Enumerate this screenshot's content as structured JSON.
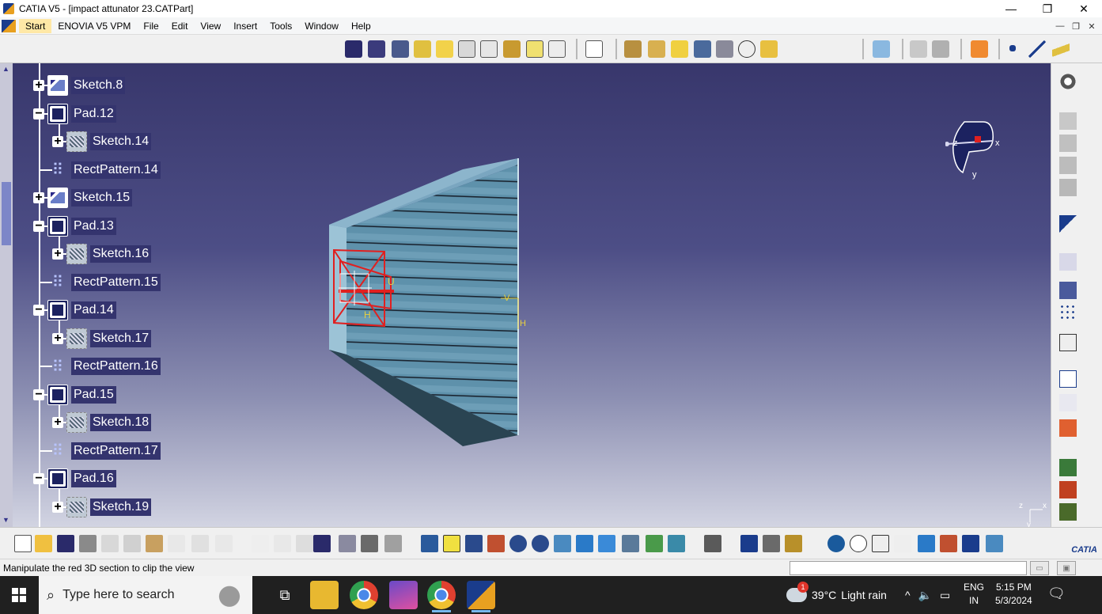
{
  "window": {
    "title": "CATIA V5 - [impact attunator 23.CATPart]",
    "minimize": "—",
    "restore": "❐",
    "close": "✕"
  },
  "menu": {
    "items": [
      "Start",
      "ENOVIA V5 VPM",
      "File",
      "Edit",
      "View",
      "Insert",
      "Tools",
      "Window",
      "Help"
    ]
  },
  "tree": {
    "nodes": [
      {
        "label": "Sketch.8",
        "type": "sketch",
        "level": 0,
        "expander": "+"
      },
      {
        "label": "Pad.12",
        "type": "pad",
        "level": 0,
        "expander": "−"
      },
      {
        "label": "Sketch.14",
        "type": "sketchp",
        "level": 1,
        "expander": "+"
      },
      {
        "label": "RectPattern.14",
        "type": "rect",
        "level": 0,
        "expander": ""
      },
      {
        "label": "Sketch.15",
        "type": "sketch",
        "level": 0,
        "expander": "+"
      },
      {
        "label": "Pad.13",
        "type": "pad",
        "level": 0,
        "expander": "−"
      },
      {
        "label": "Sketch.16",
        "type": "sketchp",
        "level": 1,
        "expander": "+"
      },
      {
        "label": "RectPattern.15",
        "type": "rect",
        "level": 0,
        "expander": ""
      },
      {
        "label": "Pad.14",
        "type": "pad",
        "level": 0,
        "expander": "−"
      },
      {
        "label": "Sketch.17",
        "type": "sketchp",
        "level": 1,
        "expander": "+"
      },
      {
        "label": "RectPattern.16",
        "type": "rect",
        "level": 0,
        "expander": ""
      },
      {
        "label": "Pad.15",
        "type": "pad",
        "level": 0,
        "expander": "−"
      },
      {
        "label": "Sketch.18",
        "type": "sketchp",
        "level": 1,
        "expander": "+"
      },
      {
        "label": "RectPattern.17",
        "type": "rect",
        "level": 0,
        "expander": ""
      },
      {
        "label": "Pad.16",
        "type": "pad",
        "level": 0,
        "expander": "−"
      },
      {
        "label": "Sketch.19",
        "type": "sketchp",
        "level": 1,
        "expander": "+"
      }
    ]
  },
  "viewport": {
    "section_labels": {
      "v": "V",
      "h": "H",
      "u": "U"
    },
    "compass": {
      "x": "x",
      "y": "y",
      "z": "z"
    },
    "axis": {
      "z": "z",
      "x": "x",
      "y": "y"
    }
  },
  "status": {
    "message": "Manipulate the red 3D section to clip the view",
    "command_input": ""
  },
  "taskbar": {
    "search_placeholder": "Type here to search",
    "weather_temp": "39°C",
    "weather_desc": "Light rain",
    "weather_badge": "1",
    "lang_top": "ENG",
    "lang_bottom": "IN",
    "time": "5:15 PM",
    "date": "5/3/2024"
  },
  "colors": {
    "viewport_top": "#38376c",
    "tree_label_bg": "#34346e",
    "section_red": "#e02020",
    "model_blue": "#5d8fa9",
    "accent_yellow": "#ffe8a6"
  }
}
